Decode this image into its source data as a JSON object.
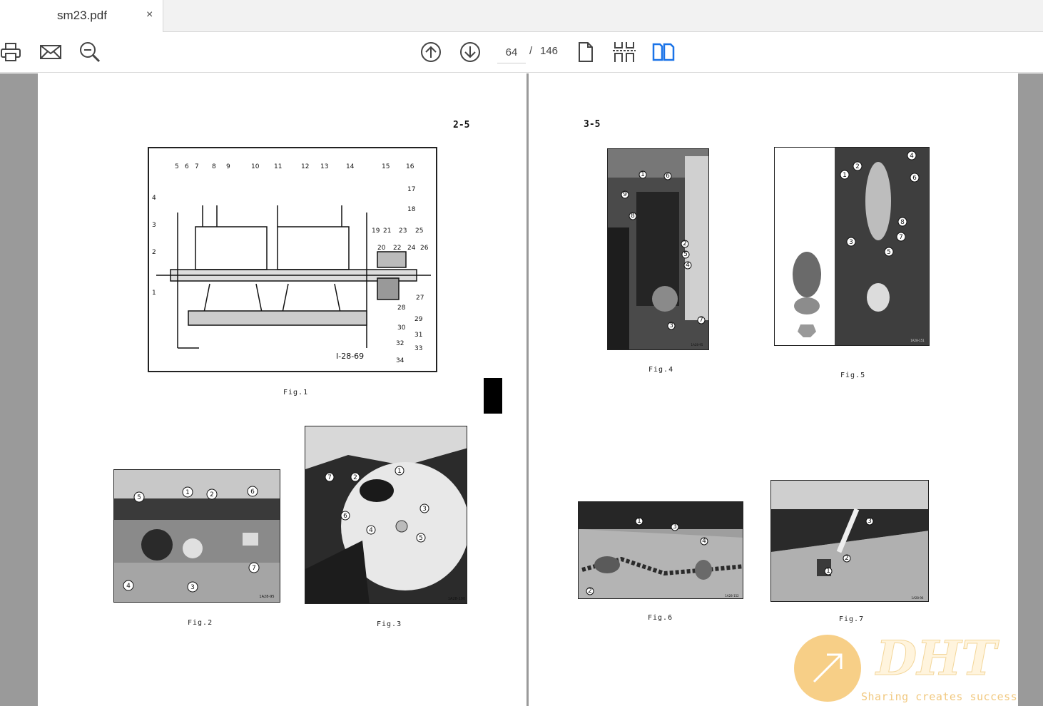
{
  "tab": {
    "title": "sm23.pdf",
    "close": "×"
  },
  "toolbar": {
    "icons": [
      "printer-icon",
      "mail-icon",
      "zoom-icon",
      "page-up-icon",
      "page-down-icon",
      "single-page-icon",
      "multi-page-icon",
      "two-page-icon"
    ],
    "current_page": "64",
    "separator": "/",
    "total_pages": "146",
    "accent": "#1a73e8"
  },
  "left_page": {
    "page_number": "2-5",
    "fig1_caption": "Fig.1",
    "fig1_code": "I-28-69",
    "fig1_callouts": [
      "1",
      "2",
      "3",
      "4",
      "5",
      "6",
      "7",
      "8",
      "9",
      "10",
      "11",
      "12",
      "13",
      "14",
      "15",
      "16",
      "17",
      "18",
      "19",
      "20",
      "21",
      "22",
      "23",
      "24",
      "25",
      "26",
      "27",
      "28",
      "29",
      "30",
      "31",
      "32",
      "33",
      "34"
    ],
    "fig2_caption": "Fig.2",
    "fig2_code": "1A28-95",
    "fig2_callouts": [
      "1",
      "2",
      "3",
      "4",
      "5",
      "6",
      "7"
    ],
    "fig3_caption": "Fig.3",
    "fig3_code": "1A28-190",
    "fig3_callouts": [
      "1",
      "2",
      "3",
      "4",
      "5",
      "6",
      "7"
    ]
  },
  "right_page": {
    "page_number": "3-5",
    "fig4_caption": "Fig.4",
    "fig4_code": "1A28-95",
    "fig4_callouts": [
      "1",
      "2",
      "3",
      "4",
      "5",
      "6",
      "7",
      "8",
      "9"
    ],
    "fig5_caption": "Fig.5",
    "fig5_code": "1A28-151",
    "fig5_callouts": [
      "1",
      "2",
      "3",
      "4",
      "5",
      "6",
      "7",
      "8"
    ],
    "fig6_caption": "Fig.6",
    "fig6_code": "1A28-152",
    "fig6_callouts": [
      "1",
      "2",
      "3",
      "4"
    ],
    "fig7_caption": "Fig.7",
    "fig7_code": "1A28-96",
    "fig7_callouts": [
      "1",
      "2",
      "3"
    ]
  },
  "watermark": {
    "brand": "DHT",
    "tagline": "Sharing creates success",
    "color": "#f5c060"
  }
}
